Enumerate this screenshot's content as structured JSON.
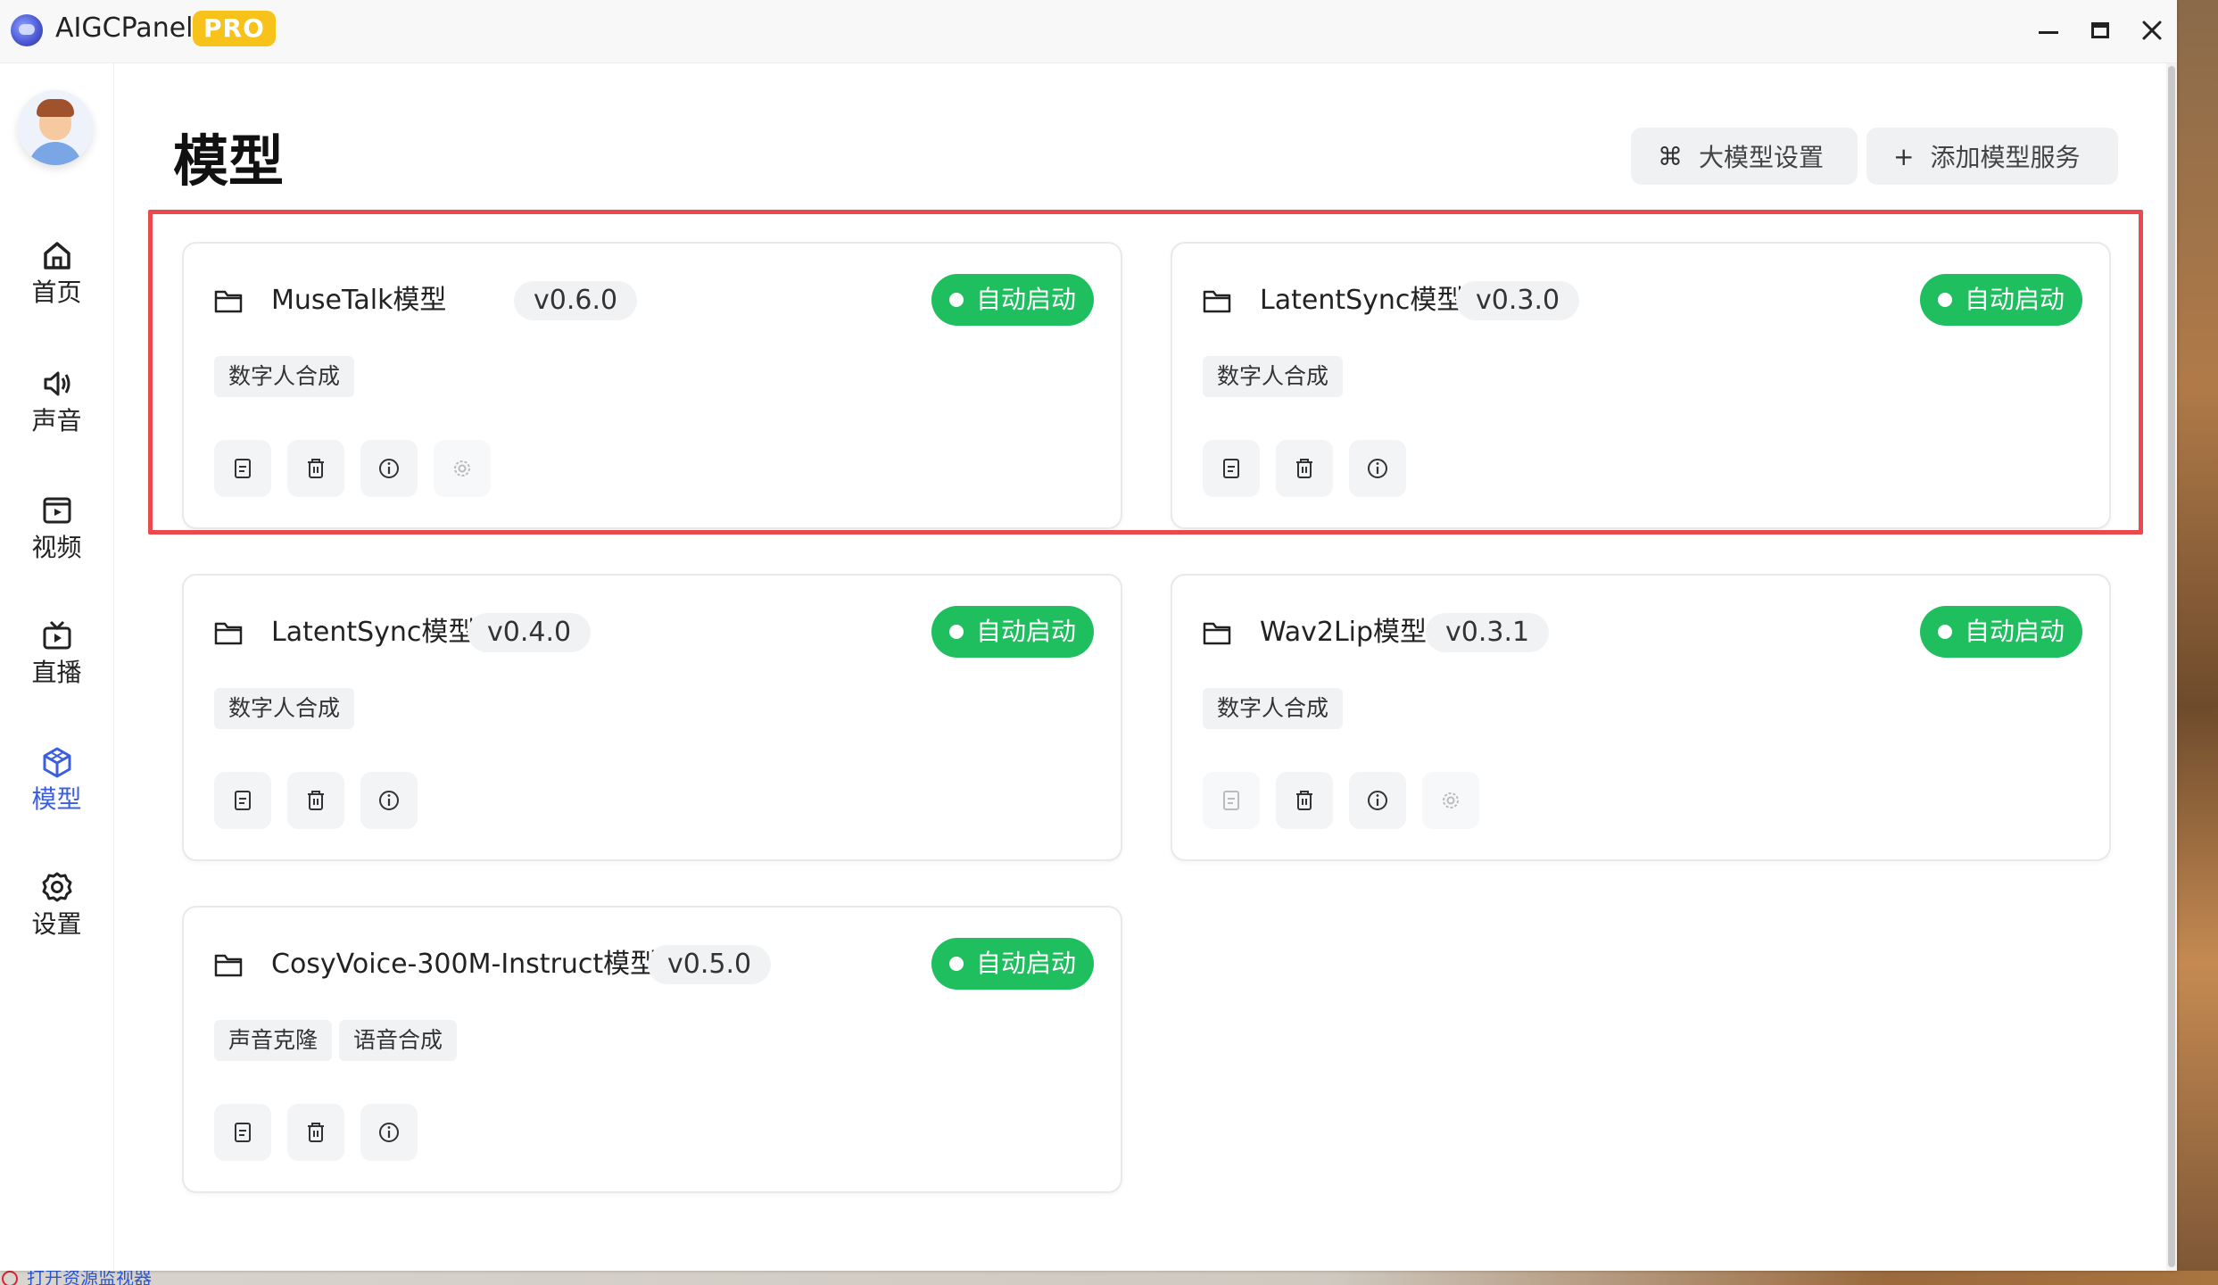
{
  "window": {
    "app_title": "AIGCPanel",
    "pro_badge": "PRO",
    "controls": [
      "minimize",
      "maximize",
      "close"
    ]
  },
  "sidebar": {
    "items": [
      {
        "label": "首页",
        "icon": "home-icon",
        "active": false
      },
      {
        "label": "声音",
        "icon": "speaker-icon",
        "active": false
      },
      {
        "label": "视频",
        "icon": "video-icon",
        "active": false
      },
      {
        "label": "直播",
        "icon": "tv-icon",
        "active": false
      },
      {
        "label": "模型",
        "icon": "cube-icon",
        "active": true
      },
      {
        "label": "设置",
        "icon": "gear-icon",
        "active": false
      }
    ]
  },
  "header": {
    "title": "模型",
    "llm_settings_icon": "⌘",
    "llm_settings_label": "大模型设置",
    "add_service_icon": "+",
    "add_service_label": "添加模型服务"
  },
  "cards": [
    {
      "name": "MuseTalk模型",
      "version": "v0.6.0",
      "status": "自动启动",
      "tags": [
        "数字人合成"
      ],
      "actions": [
        "log",
        "delete",
        "info",
        "settings-disabled"
      ]
    },
    {
      "name": "LatentSync模型",
      "version": "v0.3.0",
      "status": "自动启动",
      "tags": [
        "数字人合成"
      ],
      "actions": [
        "log",
        "delete",
        "info"
      ]
    },
    {
      "name": "LatentSync模型",
      "version": "v0.4.0",
      "status": "自动启动",
      "tags": [
        "数字人合成"
      ],
      "actions": [
        "log",
        "delete",
        "info"
      ]
    },
    {
      "name": "Wav2Lip模型",
      "version": "v0.3.1",
      "status": "自动启动",
      "tags": [
        "数字人合成"
      ],
      "actions": [
        "log-disabled",
        "delete",
        "info",
        "settings-disabled"
      ]
    },
    {
      "name": "CosyVoice-300M-Instruct模型",
      "version": "v0.5.0",
      "status": "自动启动",
      "tags": [
        "声音克隆",
        "语音合成"
      ],
      "actions": [
        "log",
        "delete",
        "info"
      ]
    }
  ],
  "taskbar_hint": "打开资源监视器",
  "colors": {
    "accent": "#3b5fe0",
    "status_green": "#1fbe5f",
    "pro_yellow": "#f7c21a",
    "highlight_red": "#ea4a4e"
  }
}
